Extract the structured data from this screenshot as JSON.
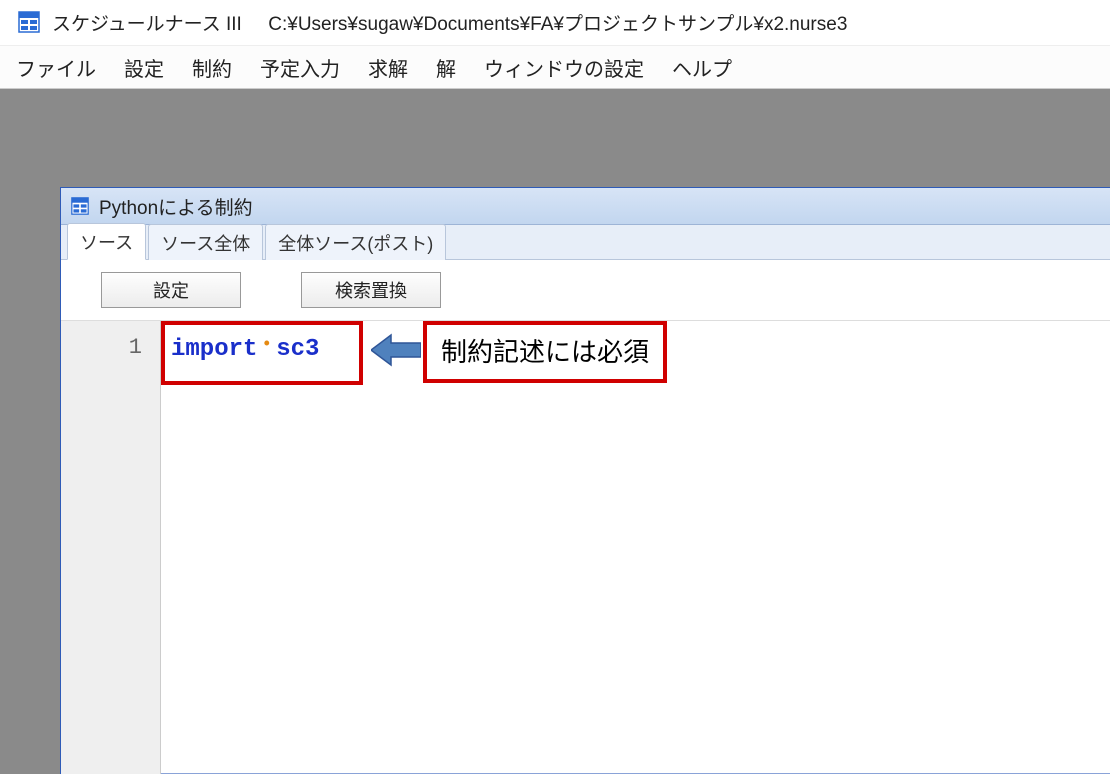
{
  "window": {
    "app_name": "スケジュールナース III",
    "file_path": "C:¥Users¥sugaw¥Documents¥FA¥プロジェクトサンプル¥x2.nurse3"
  },
  "menu": {
    "items": [
      "ファイル",
      "設定",
      "制約",
      "予定入力",
      "求解",
      "解",
      "ウィンドウの設定",
      "ヘルプ"
    ]
  },
  "child_window": {
    "title": "Pythonによる制約",
    "tabs": [
      {
        "label": "ソース",
        "active": true
      },
      {
        "label": "ソース全体",
        "active": false
      },
      {
        "label": "全体ソース(ポスト)",
        "active": false
      }
    ],
    "toolbar": {
      "settings_label": "設定",
      "search_replace_label": "検索置換"
    },
    "editor": {
      "line_numbers": [
        "1"
      ],
      "code_lines": [
        {
          "keyword": "import",
          "module": "sc3"
        }
      ]
    }
  },
  "annotation": {
    "text": "制約記述には必須"
  },
  "colors": {
    "highlight_border": "#d00000",
    "arrow_fill": "#4f81bd",
    "keyword": "#1a2fca",
    "dot": "#e58a12"
  }
}
